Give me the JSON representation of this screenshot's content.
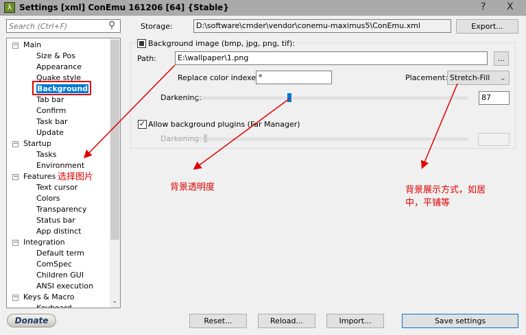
{
  "window": {
    "title": "Settings [xml] ConEmu 161206 [64] {Stable}",
    "help": "?",
    "close": "X",
    "icon": "λ"
  },
  "search": {
    "placeholder": "Search (Ctrl+F)"
  },
  "tree": [
    {
      "label": "Main",
      "level": 1
    },
    {
      "label": "Size & Pos",
      "level": 2
    },
    {
      "label": "Appearance",
      "level": 2
    },
    {
      "label": "Quake style",
      "level": 2
    },
    {
      "label": "Background",
      "level": 2,
      "selected": true
    },
    {
      "label": "Tab bar",
      "level": 2
    },
    {
      "label": "Confirm",
      "level": 2
    },
    {
      "label": "Task bar",
      "level": 2
    },
    {
      "label": "Update",
      "level": 2
    },
    {
      "label": "Startup",
      "level": 1
    },
    {
      "label": "Tasks",
      "level": 2
    },
    {
      "label": "Environment",
      "level": 2
    },
    {
      "label": "Features",
      "level": 1
    },
    {
      "label": "Text cursor",
      "level": 2
    },
    {
      "label": "Colors",
      "level": 2
    },
    {
      "label": "Transparency",
      "level": 2
    },
    {
      "label": "Status bar",
      "level": 2
    },
    {
      "label": "App distinct",
      "level": 2
    },
    {
      "label": "Integration",
      "level": 1
    },
    {
      "label": "Default term",
      "level": 2
    },
    {
      "label": "ComSpec",
      "level": 2
    },
    {
      "label": "Children GUI",
      "level": 2
    },
    {
      "label": "ANSI execution",
      "level": 2
    },
    {
      "label": "Keys & Macro",
      "level": 1
    },
    {
      "label": "Keyboard",
      "level": 2
    }
  ],
  "storage": {
    "label": "Storage:",
    "value": "D:\\software\\cmder\\vendor\\conemu-maximus5\\ConEmu.xml",
    "export": "Export..."
  },
  "background": {
    "enable_label": "Background image (bmp, jpg, png, tif):",
    "enabled": true,
    "path_label": "Path:",
    "path": "E:\\wallpaper\\1.png",
    "browse": "...",
    "replace_label": "Replace color indexes:",
    "replace": "*",
    "placement_label": "Placement:",
    "placement": "Stretch-Fill",
    "darkening_label": "Darkening:",
    "darkening": "87",
    "darkening_max": 255,
    "plugins_label": "Allow background plugins (Far Manager)",
    "plugins_checked": true,
    "plugins_darkening_label": "Darkening:"
  },
  "footer": {
    "donate": "Donate",
    "reset": "Reset...",
    "reload": "Reload...",
    "import": "Import...",
    "save": "Save settings"
  },
  "annotations": {
    "select_image": "选择图片",
    "transparency": "背景透明度",
    "placement_line1": "背景展示方式，如居",
    "placement_line2": "中，平铺等",
    "color": "#e00000"
  }
}
